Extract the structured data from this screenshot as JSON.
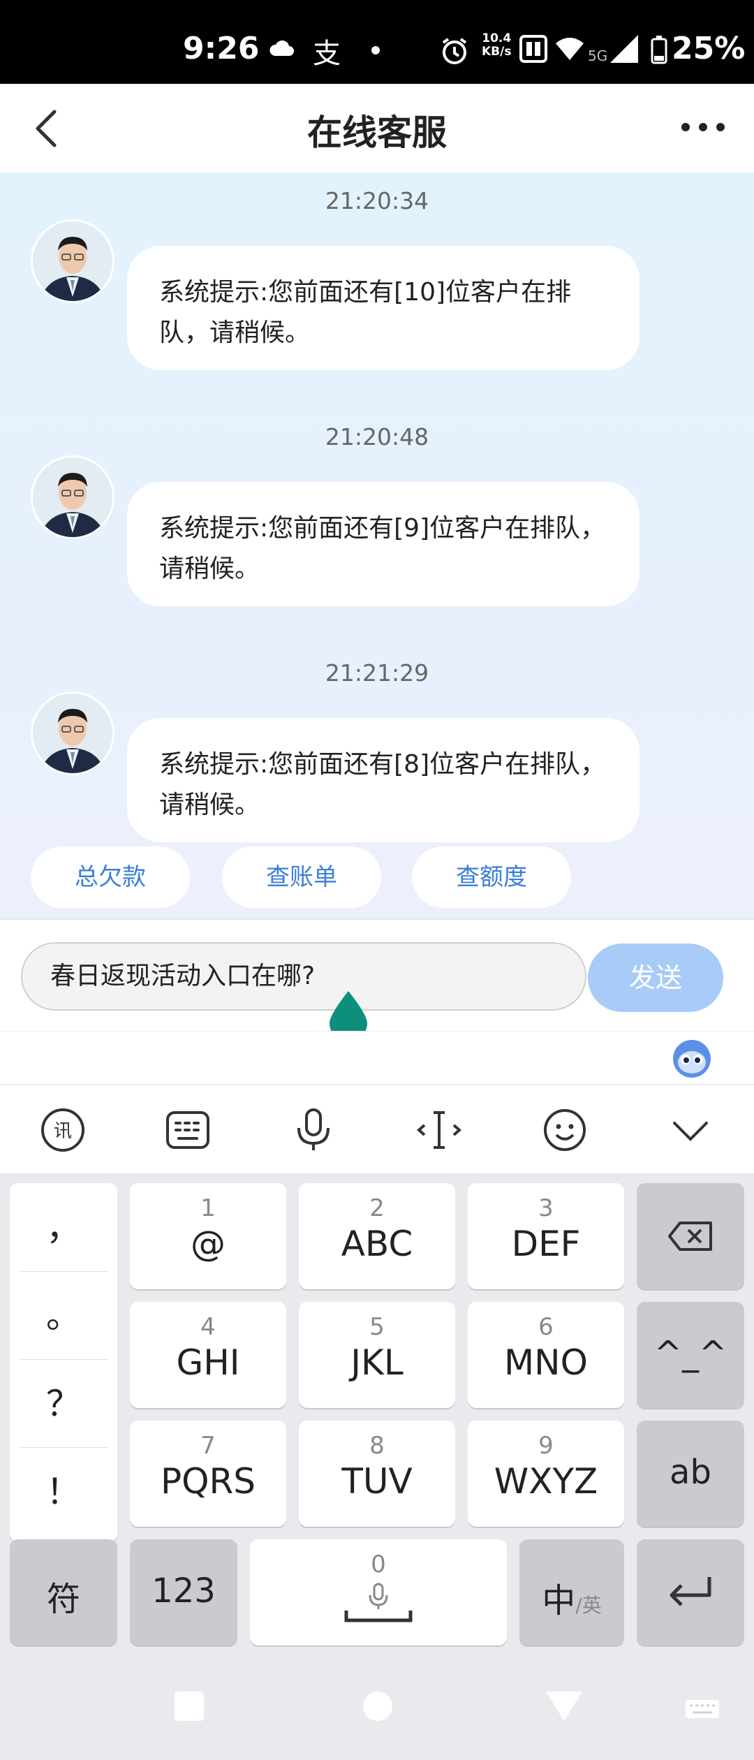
{
  "status_bar": {
    "time": "9:26",
    "speed": "10.4",
    "speed_unit": "KB/s",
    "network": "5G",
    "battery": "25%"
  },
  "header": {
    "title": "在线客服"
  },
  "messages": [
    {
      "time": "21:20:34",
      "text": "系统提示:您前面还有[10]位客户在排队，请稍候。"
    },
    {
      "time": "21:20:48",
      "text": "系统提示:您前面还有[9]位客户在排队，请稍候。"
    },
    {
      "time": "21:21:29",
      "text": "系统提示:您前面还有[8]位客户在排队，请稍候。"
    }
  ],
  "quick_actions": [
    "总欠款",
    "查账单",
    "查额度"
  ],
  "composer": {
    "value": "春日返现活动入口在哪?",
    "send_label": "发送"
  },
  "keyboard": {
    "punctuation": [
      "，",
      "。",
      "？",
      "！"
    ],
    "keys": [
      {
        "num": "1",
        "label": "@"
      },
      {
        "num": "2",
        "label": "ABC"
      },
      {
        "num": "3",
        "label": "DEF"
      },
      {
        "num": "4",
        "label": "GHI"
      },
      {
        "num": "5",
        "label": "JKL"
      },
      {
        "num": "6",
        "label": "MNO"
      },
      {
        "num": "7",
        "label": "PQRS"
      },
      {
        "num": "8",
        "label": "TUV"
      },
      {
        "num": "9",
        "label": "WXYZ"
      }
    ],
    "face_key": "^_^",
    "ab_key": "ab",
    "symbol_key": "符",
    "num_key": "123",
    "space_num": "0",
    "lang_main": "中",
    "lang_sub": "/英"
  },
  "colors": {
    "accent": "#3b7ed6",
    "send_bg": "#a8cbf7",
    "cursor_drop": "#0e8f7e"
  }
}
